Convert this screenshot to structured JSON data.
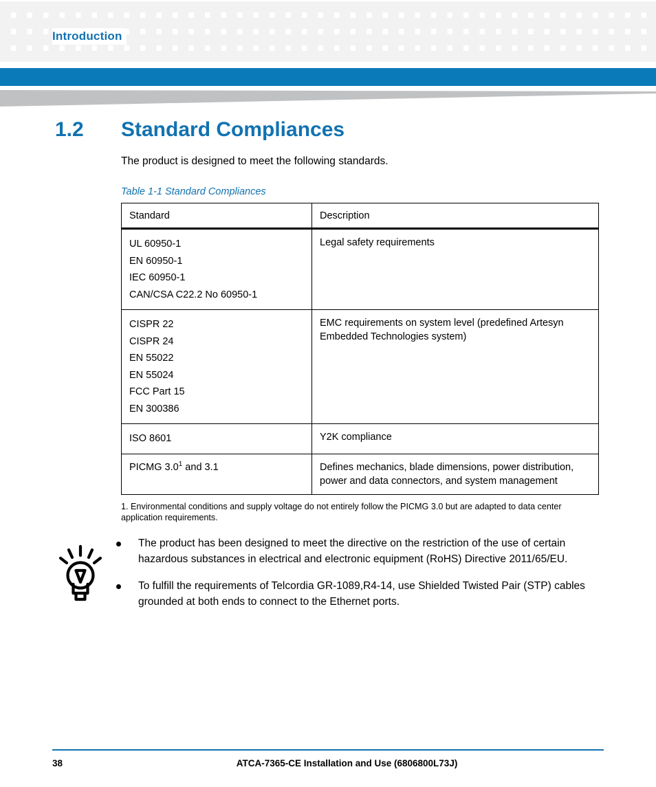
{
  "header": {
    "chapter_label": "Introduction",
    "accent_color": "#0B7AB8",
    "wedge_color": "#C0C1C3",
    "grid_color": "#F2F2F2"
  },
  "section": {
    "number": "1.2",
    "title": "Standard Compliances",
    "intro": "The product is designed to meet the following standards.",
    "heading_color": "#1272B0"
  },
  "table": {
    "caption": "Table 1-1 Standard Compliances",
    "columns": [
      "Standard",
      "Description"
    ],
    "rows": [
      {
        "standards": [
          "UL 60950-1",
          "EN 60950-1",
          "IEC 60950-1",
          "CAN/CSA C22.2 No 60950-1"
        ],
        "description": [
          "Legal safety requirements"
        ]
      },
      {
        "standards": [
          "CISPR 22",
          "CISPR 24",
          "EN 55022",
          "EN 55024",
          "FCC Part 15",
          "EN 300386"
        ],
        "description": [
          "EMC requirements on system level (predefined Artesyn",
          "Embedded Technologies system)"
        ]
      },
      {
        "standards": [
          "ISO 8601"
        ],
        "description": [
          "Y2K compliance"
        ]
      },
      {
        "standards_prefix": "PICMG 3.0",
        "standards_footnote_marker": "1",
        "standards_suffix": " and 3.1",
        "description": [
          "Defines mechanics, blade dimensions, power distribution,",
          "power and data connectors, and system management"
        ]
      }
    ],
    "footnote": "1. Environmental conditions and supply voltage do not entirely follow the PICMG 3.0 but are adapted to data center application requirements."
  },
  "note": {
    "icon": "lightbulb-icon",
    "bullets": [
      "The product has been designed to meet the directive on the restriction of the use of certain hazardous substances in electrical and electronic equipment (RoHS) Directive 2011/65/EU.",
      "To fulfill the requirements of Telcordia GR-1089,R4-14, use Shielded Twisted Pair (STP) cables grounded at both ends to connect to the Ethernet ports."
    ]
  },
  "footer": {
    "page_number": "38",
    "document_title": "ATCA-7365-CE Installation and Use (6806800L73J)",
    "rule_color": "#1272B0"
  }
}
